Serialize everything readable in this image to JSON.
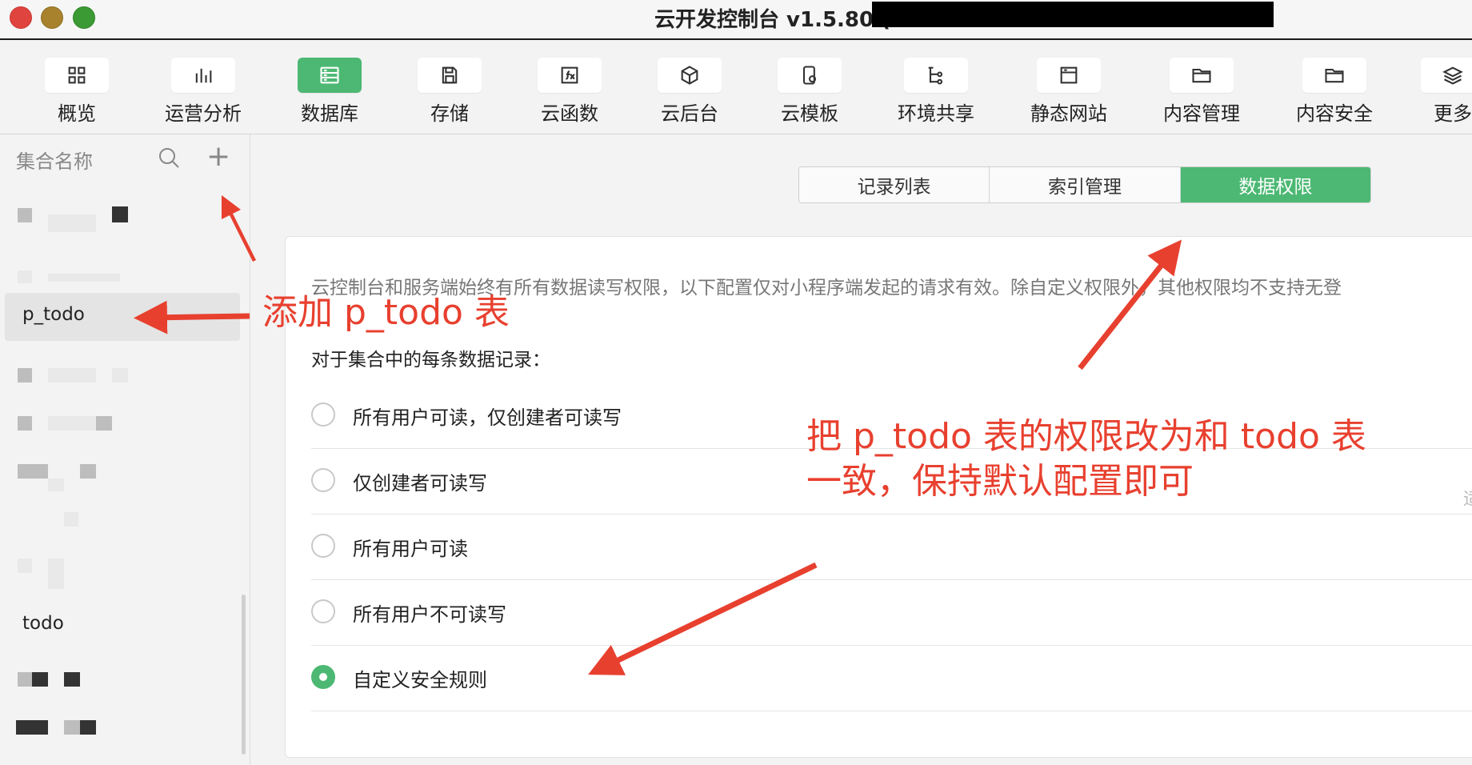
{
  "window": {
    "title": "云开发控制台 v1.5.80 (",
    "colors": {
      "close": "#e0443e",
      "minimize": "#a8822d",
      "maximize": "#3c9a34"
    }
  },
  "toolbar": {
    "accent": "#4cb873",
    "items": [
      {
        "label": "概览",
        "icon": "grid-icon"
      },
      {
        "label": "运营分析",
        "icon": "bar-chart-icon"
      },
      {
        "label": "数据库",
        "icon": "database-icon",
        "active": true
      },
      {
        "label": "存储",
        "icon": "save-icon"
      },
      {
        "label": "云函数",
        "icon": "function-icon"
      },
      {
        "label": "云后台",
        "icon": "cube-icon"
      },
      {
        "label": "云模板",
        "icon": "template-icon"
      },
      {
        "label": "环境共享",
        "icon": "tree-icon"
      },
      {
        "label": "静态网站",
        "icon": "browser-icon"
      },
      {
        "label": "内容管理",
        "icon": "folder-icon"
      },
      {
        "label": "内容安全",
        "icon": "folder-icon"
      },
      {
        "label": "更多",
        "icon": "layers-icon"
      }
    ]
  },
  "sidebar": {
    "header": "集合名称",
    "add_symbol": "+",
    "items": [
      {
        "label": "p_todo",
        "selected": true
      },
      {
        "label": "todo"
      }
    ]
  },
  "tabs": [
    {
      "label": "记录列表"
    },
    {
      "label": "索引管理"
    },
    {
      "label": "数据权限",
      "active": true
    }
  ],
  "permissions": {
    "notice": "云控制台和服务端始终有所有数据读写权限，以下配置仅对小程序端发起的请求有效。除自定义权限外，其他权限均不支持无登",
    "record_label": "对于集合中的每条数据记录：",
    "options": [
      {
        "label": "所有用户可读，仅创建者可读写",
        "checked": false
      },
      {
        "label": "仅创建者可读写",
        "checked": false
      },
      {
        "label": "所有用户可读",
        "checked": false
      },
      {
        "label": "所有用户不可读写",
        "checked": false
      },
      {
        "label": "自定义安全规则",
        "checked": true
      }
    ],
    "edge_glyph": "适"
  },
  "annotations": {
    "color": "#e8402f",
    "add_table": "添加 p_todo 表",
    "change_line1": "把 p_todo 表的权限改为和 todo 表",
    "change_line2": "一致，保持默认配置即可"
  }
}
